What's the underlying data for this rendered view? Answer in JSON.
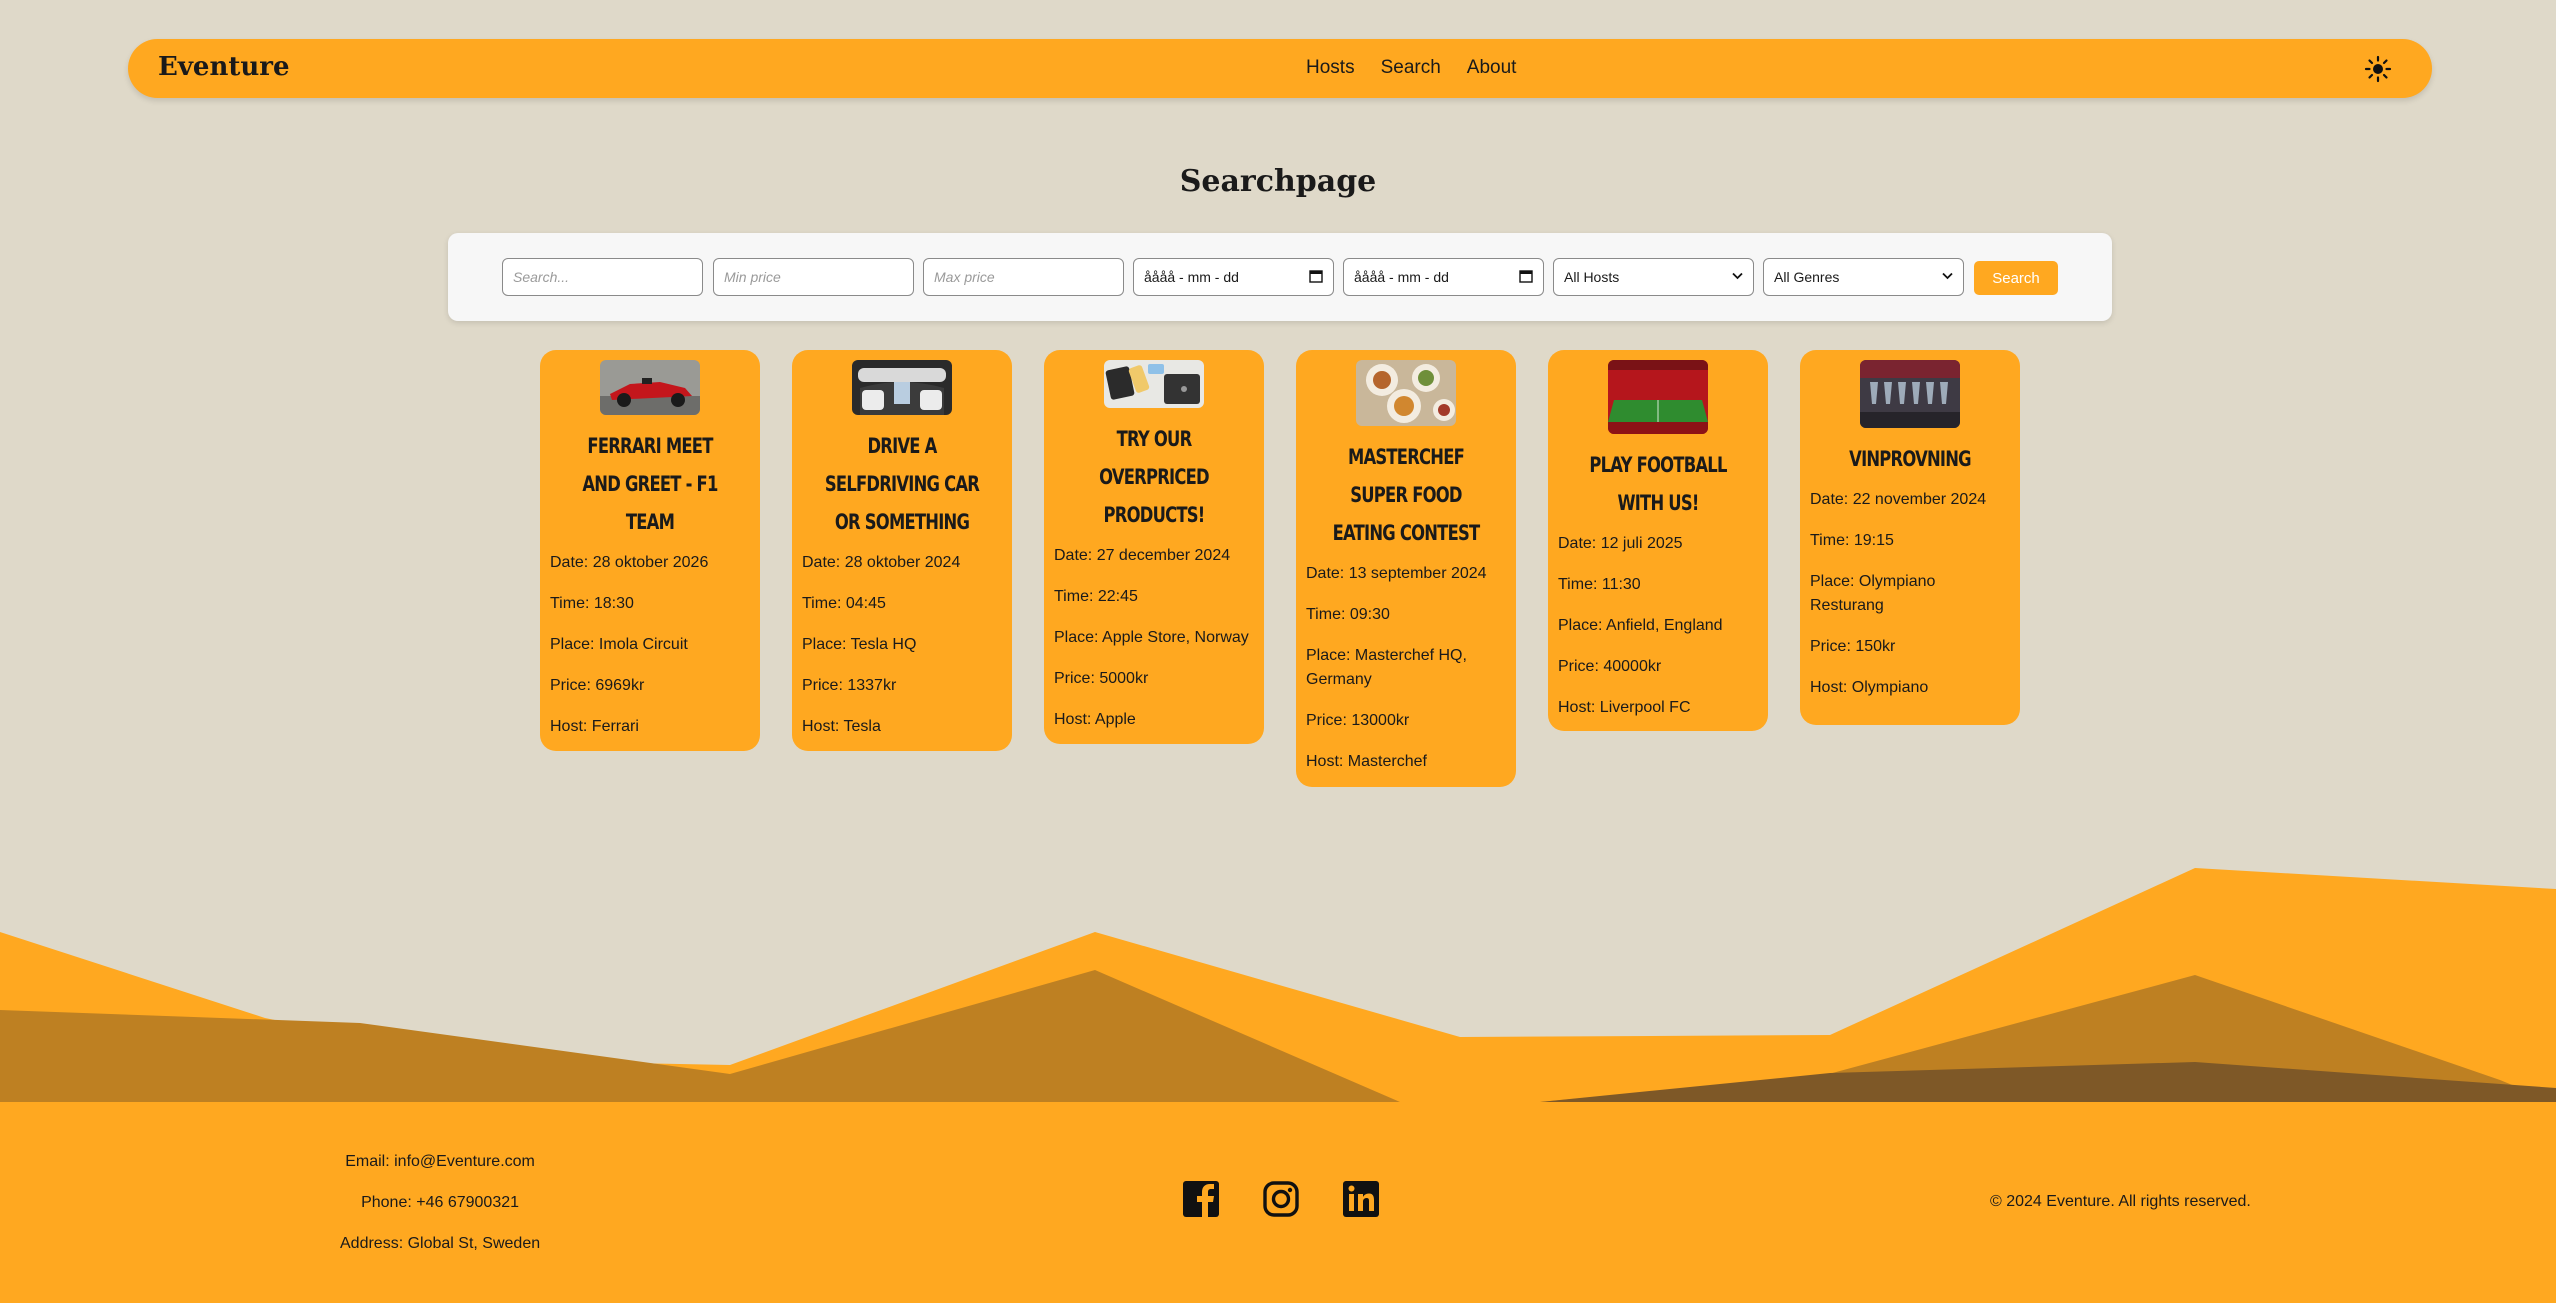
{
  "nav": {
    "brand": "Eventure",
    "links": [
      "Hosts",
      "Search",
      "About"
    ],
    "theme_icon": "sun-icon"
  },
  "page_title": "Searchpage",
  "search": {
    "text_placeholder": "Search...",
    "min_price_placeholder": "Min price",
    "max_price_placeholder": "Max price",
    "date_from": "åååå - mm - dd",
    "date_to": "åååå - mm - dd",
    "hosts_selected": "All Hosts",
    "genres_selected": "All Genres",
    "button_label": "Search"
  },
  "events": [
    {
      "title": "Ferrari Meet and Greet - F1 Team",
      "date": "Date: 28 oktober 2026",
      "time": "Time: 18:30",
      "place": "Place: Imola Circuit",
      "price": "Price: 6969kr",
      "host": "Host: Ferrari",
      "image": "red formula 1 car"
    },
    {
      "title": "Drive a selfdriving car or something",
      "date": "Date: 28 oktober 2024",
      "time": "Time: 04:45",
      "place": "Place: Tesla HQ",
      "price": "Price: 1337kr",
      "host": "Host: Tesla",
      "image": "tesla car interior"
    },
    {
      "title": "Try our overpriced products!",
      "date": "Date: 27 december 2024",
      "time": "Time: 22:45",
      "place": "Place: Apple Store, Norway",
      "price": "Price: 5000kr",
      "host": "Host: Apple",
      "image": "apple devices"
    },
    {
      "title": "Masterchef super food eating contest",
      "date": "Date: 13 september 2024",
      "time": "Time: 09:30",
      "place": "Place: Masterchef HQ, Germany",
      "price": "Price: 13000kr",
      "host": "Host: Masterchef",
      "image": "food plates"
    },
    {
      "title": "Play football with us!",
      "date": "Date: 12 juli 2025",
      "time": "Time: 11:30",
      "place": "Place: Anfield, England",
      "price": "Price: 40000kr",
      "host": "Host: Liverpool FC",
      "image": "football stadium"
    },
    {
      "title": "Vinprovning",
      "date": "Date: 22 november 2024",
      "time": "Time: 19:15",
      "place": "Place: Olympiano Resturang",
      "price": "Price: 150kr",
      "host": "Host: Olympiano",
      "image": "wine glasses"
    }
  ],
  "footer": {
    "email": "Email: info@Eventure.com",
    "phone": "Phone: +46 67900321",
    "address": "Address: Global St, Sweden",
    "social_icons": [
      "facebook-icon",
      "instagram-icon",
      "linkedin-icon"
    ],
    "copyright": "© 2024 Eventure. All rights reserved."
  },
  "colors": {
    "accent": "#ffa820",
    "background": "#dfd9c9",
    "mountain_dark": "#be8022",
    "mountain_darkest": "#7e5827"
  }
}
